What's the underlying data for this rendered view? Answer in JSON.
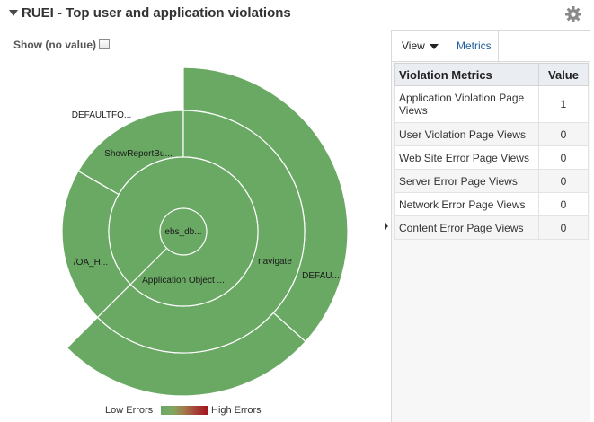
{
  "header": {
    "title": "RUEI - Top user and application violations"
  },
  "show_option": {
    "label": "Show (no value)",
    "checked": false
  },
  "sunburst": {
    "center": "ebs_db...",
    "ring1": [
      "Application Object ...",
      "navigate"
    ],
    "ring2": [
      "ShowReportBu...",
      "/OA_H..."
    ],
    "ring3": [
      "DEFAULTFO...",
      "DEFAU..."
    ],
    "fill_color": "#6aa964",
    "stroke_color": "#ffffff"
  },
  "legend": {
    "low_label": "Low Errors",
    "high_label": "High Errors"
  },
  "tabs": {
    "view_label": "View",
    "metrics_label": "Metrics"
  },
  "metrics_table": {
    "col_metric": "Violation Metrics",
    "col_value": "Value",
    "rows": [
      {
        "metric": "Application Violation Page Views",
        "value": "1"
      },
      {
        "metric": "User Violation Page Views",
        "value": "0"
      },
      {
        "metric": "Web Site Error Page Views",
        "value": "0"
      },
      {
        "metric": "Server Error Page Views",
        "value": "0"
      },
      {
        "metric": "Network Error Page Views",
        "value": "0"
      },
      {
        "metric": "Content Error Page Views",
        "value": "0"
      }
    ]
  }
}
